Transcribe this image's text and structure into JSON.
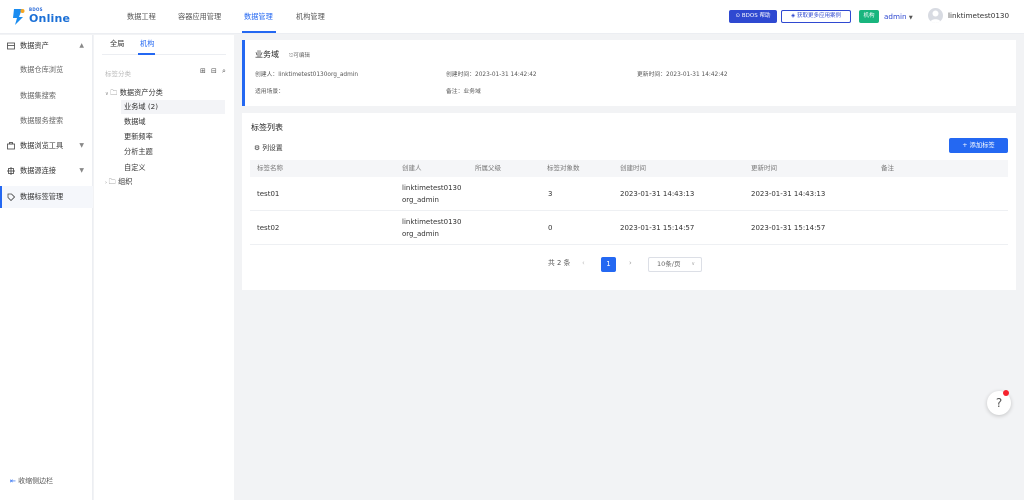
{
  "logo": {
    "small": "BDOS",
    "big": "Online"
  },
  "nav": [
    "数据工程",
    "容器应用管理",
    "数据管理",
    "机构管理"
  ],
  "header": {
    "bdos_help": "BDOS 帮助",
    "get_cases": "获取更多应用案例",
    "org_tag": "机构",
    "admin": "admin",
    "username": "linktimetest0130"
  },
  "sidebar": {
    "items": [
      "数据资产",
      "数据仓库浏览",
      "数据集搜索",
      "数据服务搜索",
      "数据浏览工具",
      "数据源连接",
      "数据标签管理"
    ],
    "collapse": "收缩侧边栏"
  },
  "tree": {
    "tabs": [
      "全局",
      "机构"
    ],
    "search_placeholder": "标签分类",
    "root": "数据资产分类",
    "children": [
      "业务域 (2)",
      "数据域",
      "更新频率",
      "分析主题",
      "自定义"
    ],
    "org": "组织"
  },
  "detail": {
    "title": "业务域",
    "edit": "可编辑",
    "creator_label": "创建人：",
    "creator": "linktimetest0130org_admin",
    "created_label": "创建时间：",
    "created": "2023-01-31 14:42:42",
    "updated_label": "更新时间：",
    "updated": "2023-01-31 14:42:42",
    "scene_label": "适用场景：",
    "remark_label": "备注：",
    "remark": "业务域"
  },
  "list": {
    "title": "标签列表",
    "column_settings": "列设置",
    "add_button": "+ 添加标签",
    "headers": [
      "标签名称",
      "创建人",
      "所属父级",
      "标签对象数",
      "创建时间",
      "更新时间",
      "备注"
    ],
    "rows": [
      {
        "name": "test01",
        "creator1": "linktimetest0130",
        "creator2": "org_admin",
        "parent": "",
        "count": "3",
        "created": "2023-01-31 14:43:13",
        "updated": "2023-01-31 14:43:13",
        "remark": ""
      },
      {
        "name": "test02",
        "creator1": "linktimetest0130",
        "creator2": "org_admin",
        "parent": "",
        "count": "0",
        "created": "2023-01-31 15:14:57",
        "updated": "2023-01-31 15:14:57",
        "remark": ""
      }
    ],
    "pagination": {
      "total": "共 2 条",
      "prev": "‹",
      "page": "1",
      "next": "›",
      "page_size": "10条/页"
    }
  },
  "help": "?"
}
